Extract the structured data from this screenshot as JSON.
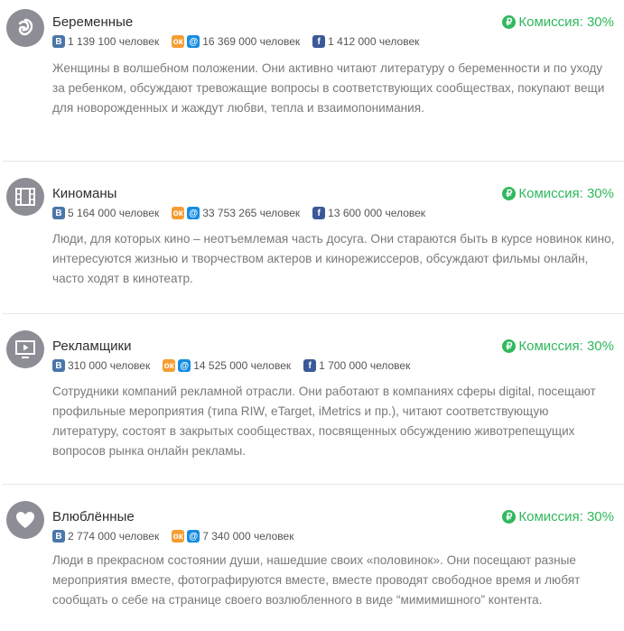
{
  "colors": {
    "accent_green": "#2fb85c",
    "avatar_gray": "#8d8d95",
    "vk": "#4a76a8",
    "ok": "#f59d33",
    "mm": "#168de2",
    "fb": "#3b5998"
  },
  "items": [
    {
      "title": "Беременные",
      "icon": "fetus-icon",
      "commission": "Комиссия: 30%",
      "vk": "1 139 100 человек",
      "ok_mm": "16 369 000 человек",
      "fb": "1 412 000 человек",
      "description": "Женщины в волшебном положении. Они активно читают литературу о беременности и по уходу за ребенком, обсуждают тревожащие вопросы в соответствующих сообществах, покупают вещи для новорожденных и жаждут любви, тепла и взаимопонимания."
    },
    {
      "title": "Киноманы",
      "icon": "film-icon",
      "commission": "Комиссия: 30%",
      "vk": "5 164 000 человек",
      "ok_mm": "33 753 265 человек",
      "fb": "13 600 000 человек",
      "description": "Люди, для которых кино – неотъемлемая часть досуга. Они стараются быть в курсе новинок кино, интересуются жизнью и творчеством актеров и кинорежиссеров, обсуждают фильмы онлайн, часто ходят в кинотеатр."
    },
    {
      "title": "Рекламщики",
      "icon": "monitor-play-icon",
      "commission": "Комиссия: 30%",
      "vk": "310 000 человек",
      "ok_mm": "14 525 000 человек",
      "fb": "1 700 000 человек",
      "description": "Сотрудники компаний рекламной отрасли. Они работают в компаниях сферы digital, посещают профильные мероприятия (типа RIW, eTarget, iMetrics и пр.), читают соответствующую литературу, состоят в закрытых сообществах, посвященных обсуждению животрепещущих вопросов рынка онлайн рекламы."
    },
    {
      "title": "Влюблённые",
      "icon": "heart-icon",
      "commission": "Комиссия: 30%",
      "vk": "2 774 000 человек",
      "ok_mm": "7 340 000 человек",
      "description": "Люди в прекрасном состоянии души, нашедшие своих «половинок». Они посещают разные мероприятия вместе, фотографируются вместе, вместе проводят свободное время и любят сообщать о себе на странице своего возлюбленного в виде “мимимишного” контента."
    }
  ]
}
